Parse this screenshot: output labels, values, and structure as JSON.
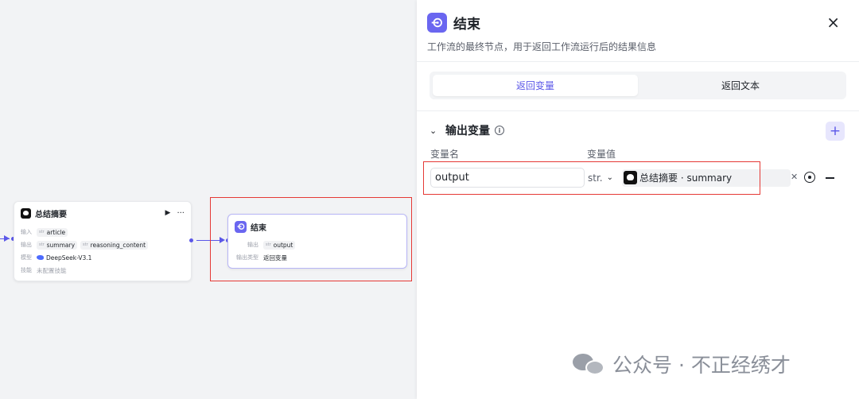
{
  "canvas": {
    "summary_node": {
      "title": "总结摘要",
      "run_icon": "▶",
      "more_icon": "···",
      "input_label": "输入",
      "inputs": [
        {
          "type": "str",
          "name": "article"
        }
      ],
      "output_label": "输出",
      "outputs": [
        {
          "type": "str",
          "name": "summary"
        },
        {
          "type": "str",
          "name": "reasoning_content"
        }
      ],
      "model_label": "模型",
      "model_value": "DeepSeek-V3.1",
      "skill_label": "技能",
      "skill_value": "未配置技能"
    },
    "end_node": {
      "title": "结束",
      "output_label": "输出",
      "output": {
        "type": "str",
        "name": "output"
      },
      "output_type_label": "输出类型",
      "output_type_value": "返回变量"
    },
    "accent_color": "#5b57e8",
    "highlight_color": "#e53935"
  },
  "panel": {
    "title": "结束",
    "close_icon": "×",
    "description": "工作流的最终节点，用于返回工作流运行后的结果信息",
    "tabs": [
      {
        "label": "返回变量",
        "active": true
      },
      {
        "label": "返回文本",
        "active": false
      }
    ],
    "section": {
      "title": "输出变量",
      "info_icon": "i",
      "add_icon": "+"
    },
    "columns": {
      "name": "变量名",
      "value": "变量值"
    },
    "variables": [
      {
        "name": "output",
        "type": "str.",
        "ref_node": "总结摘要",
        "ref_separator": "·",
        "ref_field": "summary"
      }
    ],
    "remove_icon": "−"
  },
  "watermark": {
    "text": "公众号 · 不正经绣才"
  }
}
